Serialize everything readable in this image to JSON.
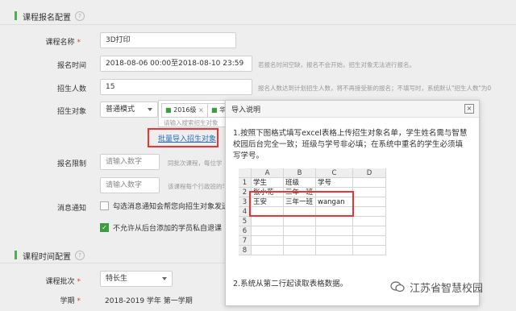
{
  "section1": {
    "title": "课程报名配置",
    "help": "?"
  },
  "form": {
    "course_name": {
      "label": "课程名称",
      "required": "*",
      "value": "3D打印"
    },
    "enroll_time": {
      "label": "报名时间",
      "value": "2018-08-06 00:00至2018-08-10 23:59",
      "hint": "若报名时间空缺，报名不会开始，招生对象无法进行报名。"
    },
    "enroll_count": {
      "label": "招生人数",
      "value": "15",
      "hint": "报名人数达到计划招生人数，将不再接受新的报名；不填写时，系统默认\"招生人数\"为0"
    },
    "target": {
      "label": "招生对象",
      "mode": "普通模式",
      "tags": [
        "2016级",
        "华"
      ],
      "search_placeholder": "请输入搜索招生对象",
      "import_link": "批量导入招生对象"
    },
    "limit": {
      "label": "报名限制",
      "placeholder1": "请输入数字",
      "hint1": "同批次课程，每位学",
      "placeholder2": "请输入数字",
      "hint2": "该课程每个行政班的学"
    },
    "notify": {
      "label": "消息通知",
      "option1": "勾选消息通知会帮您向招生对象发送",
      "option2": "不允许从后台添加的学员私自退课"
    }
  },
  "section2": {
    "title": "课程时间配置",
    "help": "?"
  },
  "form2": {
    "batch": {
      "label": "课程批次",
      "required": "*",
      "value": "特长生"
    },
    "term": {
      "label": "学期",
      "required": "*",
      "value": "2018-2019 学年  第一学期"
    }
  },
  "modal": {
    "title": "导入说明",
    "close": "×",
    "step1": "1.按照下图格式填写excel表格上传招生对象名单，学生姓名需与智慧校园后台完全一致；班级与学号非必填；在系统中重名的学生必须填写学号。",
    "step2": "2.系统从第二行起读取表格数据。",
    "sheet": {
      "columns": [
        "A",
        "B",
        "C",
        "D"
      ],
      "rows": [
        {
          "num": "1",
          "cells": [
            "学生",
            "班级",
            "学号",
            ""
          ]
        },
        {
          "num": "2",
          "cells": [
            "张小花",
            "三年一班",
            "",
            ""
          ]
        },
        {
          "num": "3",
          "cells": [
            "王安",
            "三年一班",
            "wangan",
            ""
          ]
        },
        {
          "num": "4",
          "cells": [
            "",
            "",
            "",
            ""
          ]
        },
        {
          "num": "5",
          "cells": [
            "",
            "",
            "",
            ""
          ]
        },
        {
          "num": "6",
          "cells": [
            "",
            "",
            "",
            ""
          ]
        },
        {
          "num": "7",
          "cells": [
            "",
            "",
            "",
            ""
          ]
        },
        {
          "num": "8",
          "cells": [
            "",
            "",
            "",
            ""
          ]
        }
      ]
    }
  },
  "watermark": "江苏省智慧校园",
  "colors": {
    "accent": "#4caf50",
    "link": "#2a6ebb",
    "highlight": "#e33333"
  }
}
